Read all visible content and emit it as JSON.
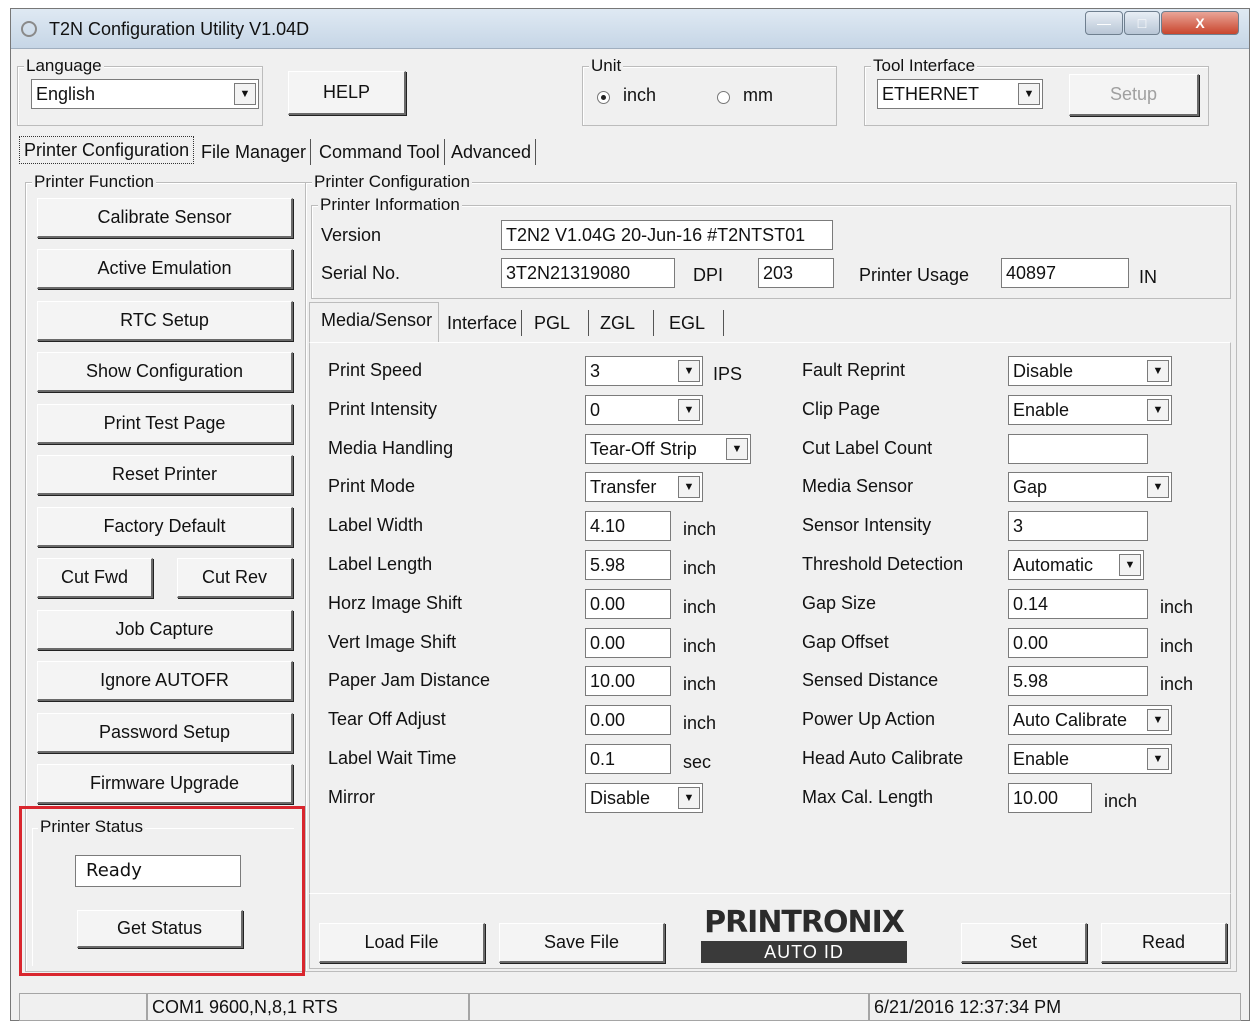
{
  "window": {
    "title": "T2N Configuration Utility V1.04D",
    "min": "—",
    "max": "□",
    "close": "X"
  },
  "top": {
    "language_label": "Language",
    "language_value": "English",
    "help": "HELP",
    "unit_label": "Unit",
    "unit_inch": "inch",
    "unit_mm": "mm",
    "unit_selected": "inch",
    "tool_label": "Tool Interface",
    "tool_value": "ETHERNET",
    "setup": "Setup"
  },
  "tabs": [
    "Printer Configuration",
    "File Manager",
    "Command Tool",
    "Advanced"
  ],
  "printer_function": {
    "label": "Printer Function",
    "buttons": [
      "Calibrate Sensor",
      "Active Emulation",
      "RTC Setup",
      "Show Configuration",
      "Print Test Page",
      "Reset Printer",
      "Factory Default"
    ],
    "cut_fwd": "Cut Fwd",
    "cut_rev": "Cut Rev",
    "buttons2": [
      "Job Capture",
      "Ignore AUTOFR",
      "Password Setup",
      "Firmware Upgrade"
    ]
  },
  "status": {
    "label": "Printer Status",
    "value": "Ready",
    "get": "Get Status",
    "highlight_color": "#d9262e"
  },
  "config": {
    "label": "Printer Configuration",
    "info_label": "Printer Information",
    "version_label": "Version",
    "version": "T2N2 V1.04G 20-Jun-16 #T2NTST01",
    "serial_label": "Serial No.",
    "serial": "3T2N21319080",
    "dpi_label": "DPI",
    "dpi": "203",
    "usage_label": "Printer Usage",
    "usage": "40897",
    "usage_unit": "IN"
  },
  "subtabs": [
    "Media/Sensor",
    "Interface",
    "PGL",
    "ZGL",
    "EGL"
  ],
  "left_settings": [
    {
      "label": "Print Speed",
      "value": "3",
      "kind": "combo",
      "unit": "IPS"
    },
    {
      "label": "Print Intensity",
      "value": "0",
      "kind": "combo",
      "unit": ""
    },
    {
      "label": "Media Handling",
      "value": "Tear-Off Strip",
      "kind": "combo",
      "unit": ""
    },
    {
      "label": "Print Mode",
      "value": "Transfer",
      "kind": "combo",
      "unit": ""
    },
    {
      "label": "Label Width",
      "value": "4.10",
      "kind": "field",
      "unit": "inch"
    },
    {
      "label": "Label Length",
      "value": "5.98",
      "kind": "field",
      "unit": "inch"
    },
    {
      "label": "Horz Image Shift",
      "value": "0.00",
      "kind": "field",
      "unit": "inch"
    },
    {
      "label": "Vert Image Shift",
      "value": "0.00",
      "kind": "field",
      "unit": "inch"
    },
    {
      "label": "Paper Jam Distance",
      "value": "10.00",
      "kind": "field",
      "unit": "inch"
    },
    {
      "label": "Tear Off Adjust",
      "value": "0.00",
      "kind": "field",
      "unit": "inch"
    },
    {
      "label": "Label Wait Time",
      "value": "0.1",
      "kind": "field",
      "unit": "sec"
    },
    {
      "label": "Mirror",
      "value": "Disable",
      "kind": "combo",
      "unit": ""
    }
  ],
  "right_settings": [
    {
      "label": "Fault Reprint",
      "value": "Disable",
      "kind": "combo",
      "unit": ""
    },
    {
      "label": "Clip Page",
      "value": "Enable",
      "kind": "combo",
      "unit": ""
    },
    {
      "label": "Cut Label Count",
      "value": "",
      "kind": "field",
      "unit": ""
    },
    {
      "label": "Media Sensor",
      "value": "Gap",
      "kind": "combo",
      "unit": ""
    },
    {
      "label": "Sensor Intensity",
      "value": "3",
      "kind": "field",
      "unit": ""
    },
    {
      "label": "Threshold Detection",
      "value": "Automatic",
      "kind": "combo",
      "unit": ""
    },
    {
      "label": "Gap Size",
      "value": "0.14",
      "kind": "field",
      "unit": "inch"
    },
    {
      "label": "Gap Offset",
      "value": "0.00",
      "kind": "field",
      "unit": "inch"
    },
    {
      "label": "Sensed Distance",
      "value": "5.98",
      "kind": "field",
      "unit": "inch"
    },
    {
      "label": "Power Up Action",
      "value": "Auto Calibrate",
      "kind": "combo",
      "unit": ""
    },
    {
      "label": "Head Auto Calibrate",
      "value": "Enable",
      "kind": "combo",
      "unit": ""
    },
    {
      "label": "Max Cal. Length",
      "value": "10.00",
      "kind": "field",
      "unit": "inch"
    }
  ],
  "bottom": {
    "load": "Load File",
    "save": "Save File",
    "set": "Set",
    "read": "Read",
    "logo_top": "PRINTRONIX",
    "logo_bottom": "AUTO ID"
  },
  "statusbar": {
    "port": "COM1 9600,N,8,1 RTS",
    "datetime": "6/21/2016 12:37:34 PM"
  }
}
